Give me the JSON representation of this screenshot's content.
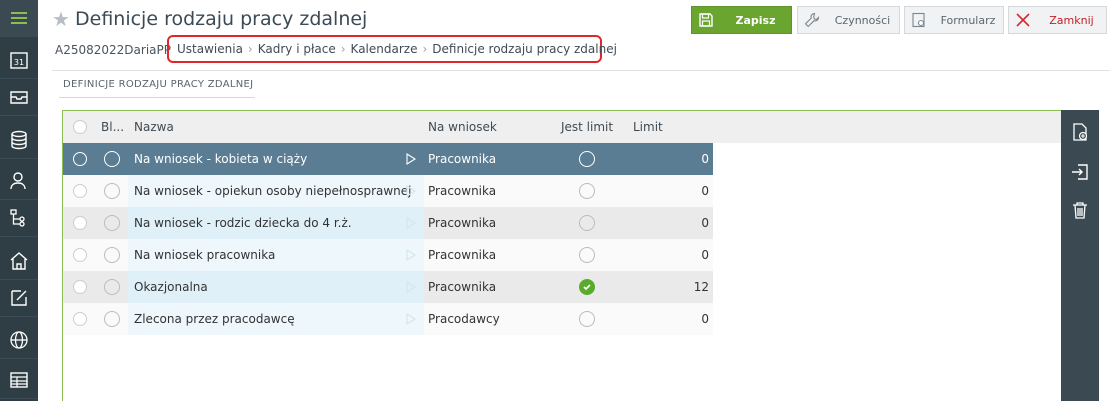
{
  "header": {
    "title": "Definicje rodzaju pracy zdalnej",
    "account": "A25082022DariaPP"
  },
  "toolbar": {
    "save_label": "Zapisz",
    "actions_label": "Czynności",
    "form_label": "Formularz",
    "close_label": "Zamknij"
  },
  "breadcrumb": [
    "Ustawienia",
    "Kadry i płace",
    "Kalendarze",
    "Definicje rodzaju pracy zdalnej"
  ],
  "section": {
    "title": "DEFINICJE RODZAJU PRACY ZDALNEJ"
  },
  "grid": {
    "columns": {
      "blocked": "Bl...",
      "name": "Nazwa",
      "on_request": "Na wniosek",
      "has_limit": "Jest limit",
      "limit": "Limit"
    },
    "rows": [
      {
        "name": "Na wniosek - kobieta w ciąży",
        "on_request": "Pracownika",
        "has_limit": false,
        "limit": "0",
        "selected": true
      },
      {
        "name": "Na wniosek - opiekun osoby niepełnosprawnej",
        "on_request": "Pracownika",
        "has_limit": false,
        "limit": "0",
        "selected": false
      },
      {
        "name": "Na wniosek - rodzic dziecka do 4 r.ż.",
        "on_request": "Pracownika",
        "has_limit": false,
        "limit": "0",
        "selected": false
      },
      {
        "name": "Na wniosek pracownika",
        "on_request": "Pracownika",
        "has_limit": false,
        "limit": "0",
        "selected": false
      },
      {
        "name": "Okazjonalna",
        "on_request": "Pracownika",
        "has_limit": true,
        "limit": "12",
        "selected": false
      },
      {
        "name": "Zlecona przez pracodawcę",
        "on_request": "Pracodawcy",
        "has_limit": false,
        "limit": "0",
        "selected": false
      }
    ]
  },
  "sidebar": {
    "icons": [
      "menu-icon",
      "calendar-icon",
      "inbox-icon",
      "database-icon",
      "users-icon",
      "org-structure-icon",
      "home-icon",
      "edit-icon",
      "globe-icon",
      "table-icon"
    ],
    "calendar_day": "31"
  },
  "right_toolbar": {
    "icons": [
      "add-document-icon",
      "import-icon",
      "delete-icon"
    ]
  },
  "colors": {
    "sidebar": "#2f3d45",
    "accent_green": "#6aa52f",
    "selected_row": "#5a7d94",
    "breadcrumb_border": "#e0262d",
    "close_red": "#c3202a"
  }
}
